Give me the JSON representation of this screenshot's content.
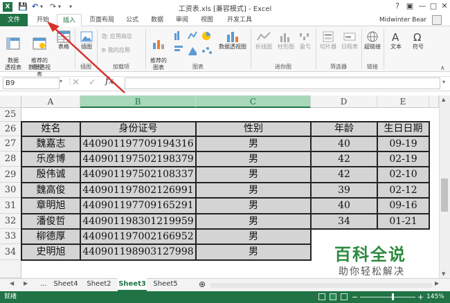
{
  "title": "工资表.xls [兼容模式] - Excel",
  "quick_access": {
    "save": "💾",
    "undo": "↶",
    "redo": "↷",
    "customize": "▾"
  },
  "window": {
    "help": "?",
    "restore": "▣",
    "minimize": "—",
    "maximize": "□",
    "close": "✕"
  },
  "user": "Midwinter Bear",
  "tabs": [
    "文件",
    "开始",
    "插入",
    "页面布局",
    "公式",
    "数据",
    "审阅",
    "视图",
    "开发工具"
  ],
  "active_tab": "插入",
  "ribbon": {
    "groups": [
      "表格",
      "插图",
      "加载项",
      "图表",
      "迷你图",
      "筛选器",
      "链接"
    ],
    "pivot": "数据\n透视表",
    "recommended_pivot": "推荐的\n数据透视表",
    "table": "表格",
    "illustrations": "插图",
    "store": "应用商店",
    "my_apps": "我的应用",
    "recommended_charts": "推荐的\n图表",
    "pivot_chart": "数据透视图",
    "line": "折线图",
    "column": "柱形图",
    "winloss": "盈亏",
    "slicer": "切片器",
    "timeline": "日程表",
    "hyperlink": "超链接",
    "text": "文本",
    "symbols": "符号"
  },
  "name_box": "B9",
  "fx": "fx",
  "columns": [
    "A",
    "B",
    "C",
    "D",
    "E"
  ],
  "rows": [
    "25",
    "26",
    "27",
    "28",
    "29",
    "30",
    "31",
    "32",
    "33",
    "34"
  ],
  "table": {
    "headers": [
      "姓名",
      "身份证号",
      "性别",
      "年龄",
      "生日日期"
    ],
    "data": [
      [
        "魏嘉志",
        "440901197709194316",
        "男",
        "40",
        "09-19"
      ],
      [
        "乐彦博",
        "440901197502198379",
        "男",
        "42",
        "02-19"
      ],
      [
        "殷伟诚",
        "440901197502108337",
        "男",
        "42",
        "02-10"
      ],
      [
        "魏高俊",
        "440901197802126991",
        "男",
        "39",
        "02-12"
      ],
      [
        "章明旭",
        "440901197709165291",
        "男",
        "40",
        "09-16"
      ],
      [
        "潘俊哲",
        "440901198301219959",
        "男",
        "34",
        "01-21"
      ],
      [
        "柳德厚",
        "440901197002166952",
        "男",
        "",
        ""
      ],
      [
        "史明旭",
        "440901198903127998",
        "男",
        "",
        ""
      ]
    ]
  },
  "sheets": [
    "...",
    "Sheet4",
    "Sheet2",
    "Sheet3",
    "Sheet5"
  ],
  "active_sheet": "Sheet3",
  "add_sheet": "⊕",
  "status": {
    "ready": "就绪",
    "zoom": "145%",
    "minus": "−",
    "plus": "+"
  },
  "watermark": {
    "title": "百科全说",
    "subtitle": "助你轻松解决"
  },
  "colors": {
    "excel_green": "#217346",
    "selected_header": "#a7d8b8",
    "grey_fill": "#d4d4d4",
    "annotation": "#d9302c",
    "watermark": "#2d8a3e"
  }
}
